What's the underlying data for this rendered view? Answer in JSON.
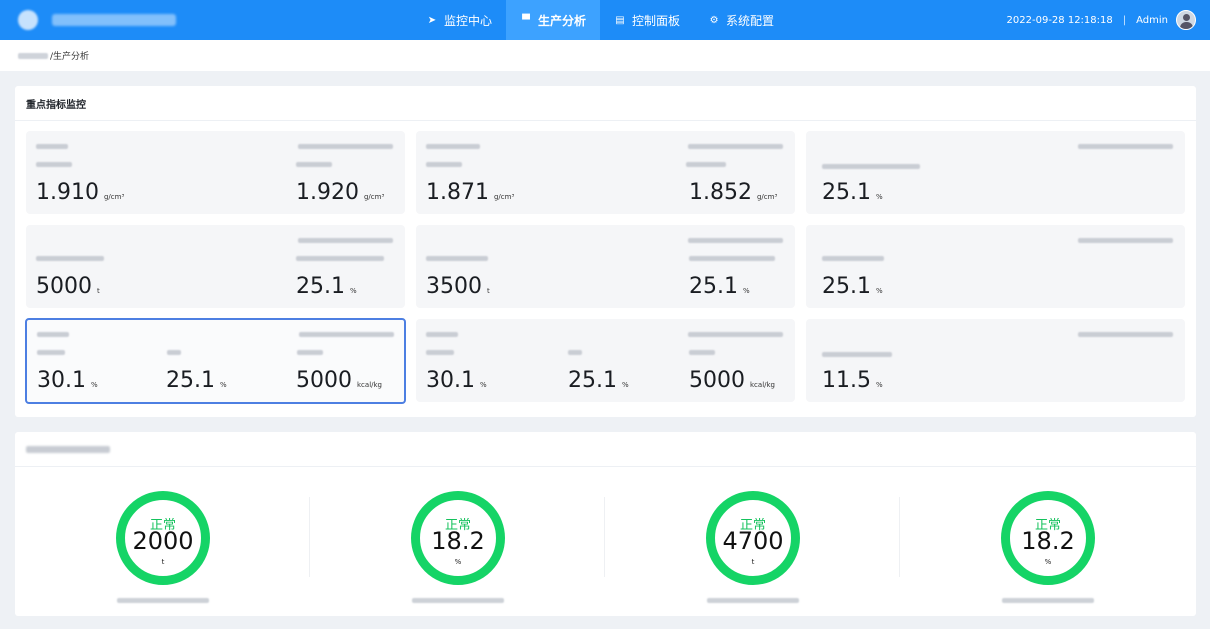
{
  "header": {
    "nav": [
      {
        "icon": "send-icon",
        "label": "监控中心",
        "active": false
      },
      {
        "icon": "chat-icon",
        "label": "生产分析",
        "active": true
      },
      {
        "icon": "table-icon",
        "label": "控制面板",
        "active": false
      },
      {
        "icon": "gear-icon",
        "label": "系统配置",
        "active": false
      }
    ],
    "datetime": "2022-09-28 12:18:18",
    "separator": "|",
    "user": "Admin"
  },
  "breadcrumb": {
    "current": "/生产分析"
  },
  "panel1": {
    "title": "重点指标监控",
    "cards": [
      {
        "values": [
          {
            "v": "1.910",
            "u": "g/cm³"
          },
          {
            "v": "1.920",
            "u": "g/cm³"
          }
        ]
      },
      {
        "values": [
          {
            "v": "1.871",
            "u": "g/cm³"
          },
          {
            "v": "1.852",
            "u": "g/cm³"
          }
        ]
      },
      {
        "values": [
          {
            "v": "25.1",
            "u": "%"
          }
        ]
      },
      {
        "values": [
          {
            "v": "5000",
            "u": "t"
          },
          {
            "v": "25.1",
            "u": "%"
          }
        ]
      },
      {
        "values": [
          {
            "v": "3500",
            "u": "t"
          },
          {
            "v": "25.1",
            "u": "%"
          }
        ]
      },
      {
        "values": [
          {
            "v": "25.1",
            "u": "%"
          }
        ]
      },
      {
        "values": [
          {
            "v": "30.1",
            "u": "%"
          },
          {
            "v": "25.1",
            "u": "%"
          },
          {
            "v": "5000",
            "u": "kcal/kg"
          }
        ]
      },
      {
        "values": [
          {
            "v": "30.1",
            "u": "%"
          },
          {
            "v": "25.1",
            "u": "%"
          },
          {
            "v": "5000",
            "u": "kcal/kg"
          }
        ]
      },
      {
        "values": [
          {
            "v": "11.5",
            "u": "%"
          }
        ]
      }
    ]
  },
  "panel2": {
    "gauges": [
      {
        "status": "正常",
        "value": "2000",
        "unit": "t"
      },
      {
        "status": "正常",
        "value": "18.2",
        "unit": "%"
      },
      {
        "status": "正常",
        "value": "4700",
        "unit": "t"
      },
      {
        "status": "正常",
        "value": "18.2",
        "unit": "%"
      }
    ]
  },
  "colors": {
    "topbar": "#1d8cf8",
    "nav_active": "#3da2ff",
    "gauge_ring": "#15d466",
    "gauge_status": "#15c25d",
    "selected_border": "#4d7fe2"
  }
}
